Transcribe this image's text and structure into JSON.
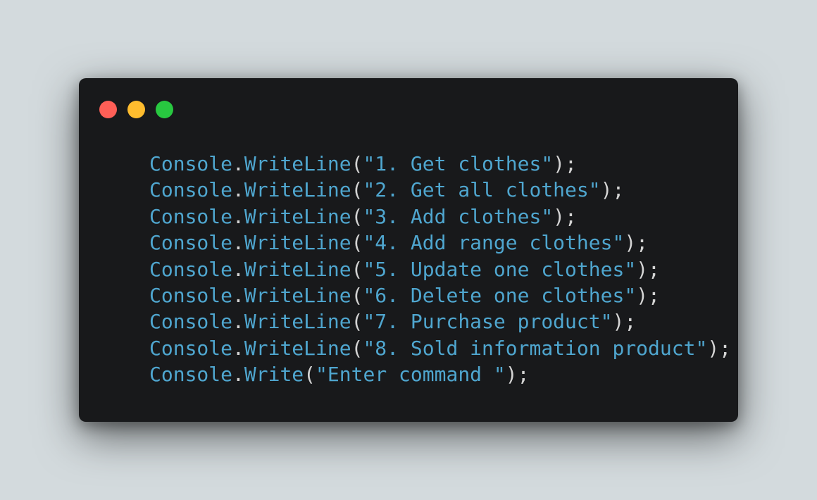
{
  "colors": {
    "background": "#d3dadd",
    "window": "#18191b",
    "close": "#ff5f57",
    "minimize": "#febc2e",
    "maximize": "#28c840",
    "code_identifier": "#4fa6cf",
    "code_punctuation": "#d4d4d4"
  },
  "window_controls": {
    "close_icon": "close-dot-icon",
    "minimize_icon": "minimize-dot-icon",
    "maximize_icon": "maximize-dot-icon"
  },
  "code": {
    "lines": [
      {
        "object": "Console",
        "method": "WriteLine",
        "string": "\"1. Get clothes\""
      },
      {
        "object": "Console",
        "method": "WriteLine",
        "string": "\"2. Get all clothes\""
      },
      {
        "object": "Console",
        "method": "WriteLine",
        "string": "\"3. Add clothes\""
      },
      {
        "object": "Console",
        "method": "WriteLine",
        "string": "\"4. Add range clothes\""
      },
      {
        "object": "Console",
        "method": "WriteLine",
        "string": "\"5. Update one clothes\""
      },
      {
        "object": "Console",
        "method": "WriteLine",
        "string": "\"6. Delete one clothes\""
      },
      {
        "object": "Console",
        "method": "WriteLine",
        "string": "\"7. Purchase product\""
      },
      {
        "object": "Console",
        "method": "WriteLine",
        "string": "\"8. Sold information product\""
      },
      {
        "object": "Console",
        "method": "Write",
        "string": "\"Enter command \""
      }
    ]
  }
}
